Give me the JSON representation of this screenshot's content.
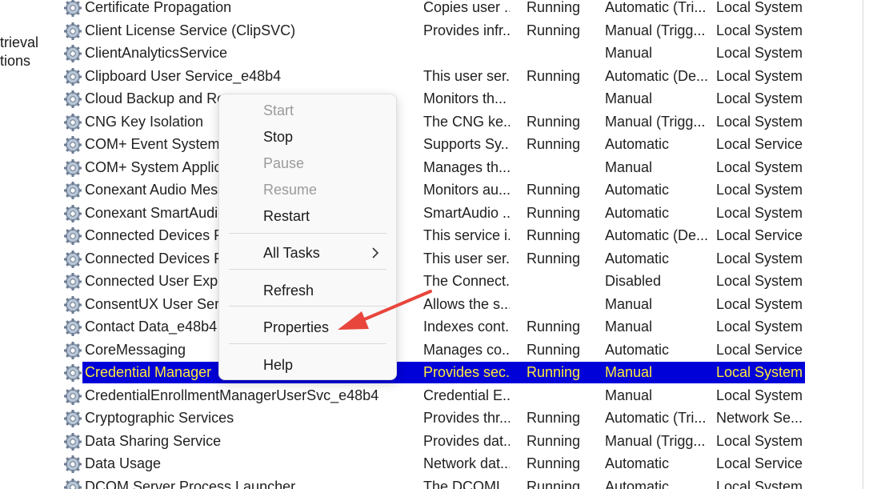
{
  "left_pane": {
    "line1": "trieval",
    "line2": "tions"
  },
  "services": [
    {
      "name": "Certificate Propagation",
      "desc": "Copies user ...",
      "status": "Running",
      "startup": "Automatic (Tri...",
      "logon": "Local System"
    },
    {
      "name": "Client License Service (ClipSVC)",
      "desc": "Provides infr...",
      "status": "Running",
      "startup": "Manual (Trigg...",
      "logon": "Local System"
    },
    {
      "name": "ClientAnalyticsService",
      "desc": "",
      "status": "",
      "startup": "Manual",
      "logon": "Local System"
    },
    {
      "name": "Clipboard User Service_e48b4",
      "desc": "This user ser...",
      "status": "Running",
      "startup": "Automatic (De...",
      "logon": "Local System"
    },
    {
      "name": "Cloud Backup and Re",
      "desc": "Monitors th...",
      "status": "",
      "startup": "Manual",
      "logon": "Local System"
    },
    {
      "name": "CNG Key Isolation",
      "desc": "The CNG ke...",
      "status": "Running",
      "startup": "Manual (Trigg...",
      "logon": "Local System"
    },
    {
      "name": "COM+ Event System",
      "desc": "Supports Sy...",
      "status": "Running",
      "startup": "Automatic",
      "logon": "Local Service"
    },
    {
      "name": "COM+ System Applic",
      "desc": "Manages th...",
      "status": "",
      "startup": "Manual",
      "logon": "Local System"
    },
    {
      "name": "Conexant Audio Mess",
      "desc": "Monitors au...",
      "status": "Running",
      "startup": "Automatic",
      "logon": "Local System"
    },
    {
      "name": "Conexant SmartAudio",
      "desc": "SmartAudio ...",
      "status": "Running",
      "startup": "Automatic",
      "logon": "Local System"
    },
    {
      "name": "Connected Devices Pl",
      "desc": "This service i...",
      "status": "Running",
      "startup": "Automatic (De...",
      "logon": "Local Service"
    },
    {
      "name": "Connected Devices Pl",
      "desc": "This user ser...",
      "status": "Running",
      "startup": "Automatic",
      "logon": "Local System"
    },
    {
      "name": "Connected User Expe",
      "desc": "The Connect...",
      "status": "",
      "startup": "Disabled",
      "logon": "Local System"
    },
    {
      "name": "ConsentUX User Servi",
      "desc": "Allows the s...",
      "status": "",
      "startup": "Manual",
      "logon": "Local System"
    },
    {
      "name": "Contact Data_e48b4",
      "desc": "Indexes cont...",
      "status": "Running",
      "startup": "Manual",
      "logon": "Local System"
    },
    {
      "name": "CoreMessaging",
      "desc": "Manages co...",
      "status": "Running",
      "startup": "Automatic",
      "logon": "Local Service"
    },
    {
      "name": "Credential Manager",
      "desc": "Provides sec...",
      "status": "Running",
      "startup": "Manual",
      "logon": "Local System",
      "selected": true
    },
    {
      "name": "CredentialEnrollmentManagerUserSvc_e48b4",
      "desc": "Credential E...",
      "status": "",
      "startup": "Manual",
      "logon": "Local System"
    },
    {
      "name": "Cryptographic Services",
      "desc": "Provides thr...",
      "status": "Running",
      "startup": "Automatic (Tri...",
      "logon": "Network Se..."
    },
    {
      "name": "Data Sharing Service",
      "desc": "Provides dat...",
      "status": "Running",
      "startup": "Manual (Trigg...",
      "logon": "Local System"
    },
    {
      "name": "Data Usage",
      "desc": "Network dat...",
      "status": "Running",
      "startup": "Automatic",
      "logon": "Local Service"
    },
    {
      "name": "DCOM Server Process Launcher",
      "desc": "The DCOML...",
      "status": "Running",
      "startup": "Automatic",
      "logon": "Local System"
    }
  ],
  "context_menu": {
    "start": "Start",
    "stop": "Stop",
    "pause": "Pause",
    "resume": "Resume",
    "restart": "Restart",
    "all_tasks": "All Tasks",
    "refresh": "Refresh",
    "properties": "Properties",
    "help": "Help"
  },
  "colors": {
    "selection_bg": "#0000d8",
    "selection_text": "#ffeb3b",
    "annotation_arrow": "#e8453c"
  }
}
